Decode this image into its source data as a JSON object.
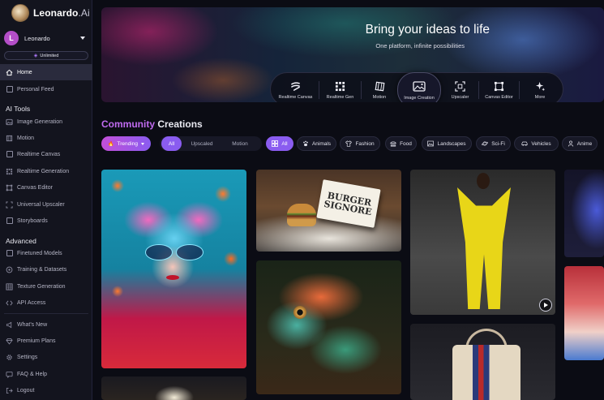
{
  "app": {
    "logo_name": "Leonardo",
    "logo_suffix": ".Ai"
  },
  "user": {
    "avatar_letter": "L",
    "name": "Leonardo",
    "plan": "Unlimited"
  },
  "sidebar": {
    "primary": [
      {
        "label": "Home",
        "icon": "home-icon",
        "active": true
      },
      {
        "label": "Personal Feed",
        "icon": "feed-icon",
        "active": false
      }
    ],
    "ai_tools_label": "AI Tools",
    "ai_tools": [
      {
        "label": "Image Generation",
        "icon": "image-icon"
      },
      {
        "label": "Motion",
        "icon": "motion-icon"
      },
      {
        "label": "Realtime Canvas",
        "icon": "realtime-canvas-icon"
      },
      {
        "label": "Realtime Generation",
        "icon": "realtime-generation-icon"
      },
      {
        "label": "Canvas Editor",
        "icon": "canvas-editor-icon"
      },
      {
        "label": "Universal Upscaler",
        "icon": "upscaler-icon"
      },
      {
        "label": "Storyboards",
        "icon": "storyboards-icon"
      }
    ],
    "advanced_label": "Advanced",
    "advanced": [
      {
        "label": "Finetuned Models",
        "icon": "finetuned-models-icon"
      },
      {
        "label": "Training & Datasets",
        "icon": "training-icon"
      },
      {
        "label": "Texture Generation",
        "icon": "texture-icon"
      },
      {
        "label": "API Access",
        "icon": "api-icon"
      }
    ],
    "footer": [
      {
        "label": "What's New",
        "icon": "megaphone-icon"
      },
      {
        "label": "Premium Plans",
        "icon": "diamond-icon"
      },
      {
        "label": "Settings",
        "icon": "gear-icon"
      },
      {
        "label": "FAQ & Help",
        "icon": "help-icon"
      },
      {
        "label": "Logout",
        "icon": "logout-icon"
      }
    ]
  },
  "hero": {
    "title": "Bring your ideas to life",
    "subtitle": "One platform, infinite possibilities",
    "tools": [
      {
        "label": "Realtime Canvas",
        "icon": "realtime-canvas-icon"
      },
      {
        "label": "Realtime Gen",
        "icon": "realtime-gen-icon"
      },
      {
        "label": "Motion",
        "icon": "motion-icon"
      },
      {
        "label": "Image Creation",
        "icon": "image-creation-icon",
        "selected": true
      },
      {
        "label": "Upscaler",
        "icon": "upscaler-icon"
      },
      {
        "label": "Canvas Editor",
        "icon": "canvas-editor-icon"
      },
      {
        "label": "More",
        "icon": "sparkle-icon"
      }
    ]
  },
  "community": {
    "title_accent": "Community",
    "title_rest": "Creations",
    "sort_label": "Trending",
    "media_filters": [
      {
        "label": "All",
        "active": true
      },
      {
        "label": "Upscaled",
        "active": false
      },
      {
        "label": "Motion",
        "active": false
      }
    ],
    "categories": [
      {
        "label": "All",
        "icon": "grid-icon",
        "active": true
      },
      {
        "label": "Animals",
        "icon": "paw-icon"
      },
      {
        "label": "Fashion",
        "icon": "shirt-icon"
      },
      {
        "label": "Food",
        "icon": "food-icon"
      },
      {
        "label": "Landscapes",
        "icon": "landscape-icon"
      },
      {
        "label": "Sci-Fi",
        "icon": "planet-icon"
      },
      {
        "label": "Vehicles",
        "icon": "car-icon"
      },
      {
        "label": "Anime",
        "icon": "person-icon"
      }
    ],
    "tile_texts": {
      "burger_box": "BURGER SIGNORE"
    }
  },
  "colors": {
    "accent": "#8a5cf0",
    "accent_pink": "#c06bf0",
    "sidebar_bg": "#13141e",
    "page_bg": "#0b0c14"
  }
}
